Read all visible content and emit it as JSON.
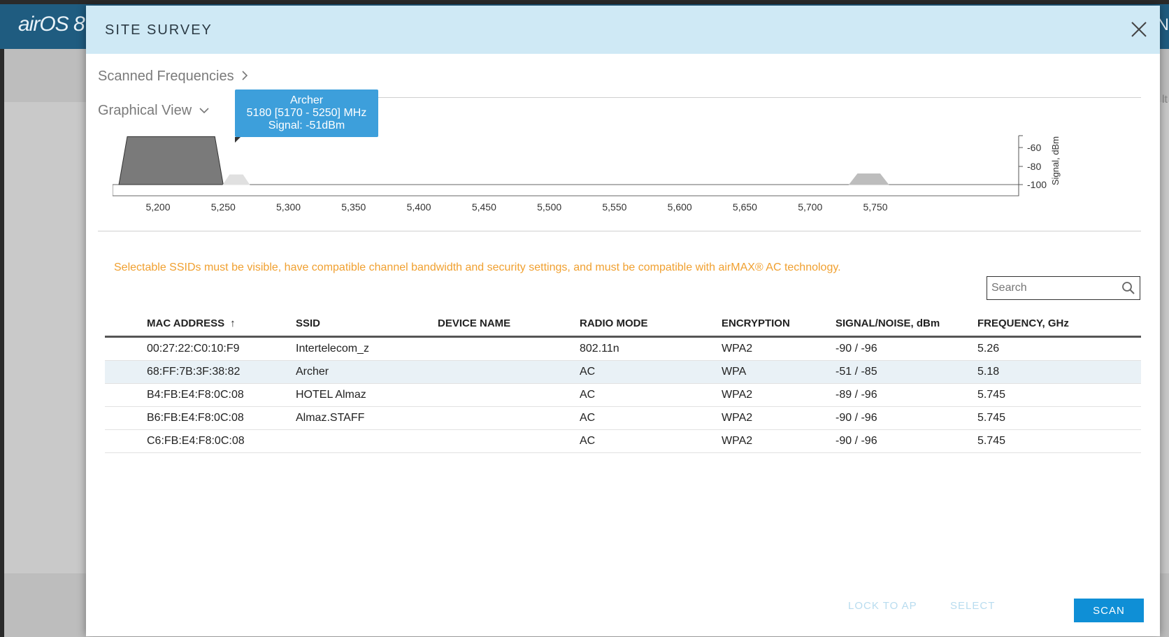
{
  "app": {
    "logo": "airOS 8",
    "edge_letter": "N",
    "edge_text": "lt"
  },
  "modal": {
    "title": "SITE SURVEY",
    "scanned_frequencies_label": "Scanned Frequencies",
    "graphical_view_label": "Graphical View",
    "tooltip": {
      "ssid": "Archer",
      "freq": "5180 [5170 - 5250] MHz",
      "signal": "Signal: -51dBm"
    },
    "notice": "Selectable SSIDs must be visible, have compatible channel bandwidth and security settings, and must be compatible with airMAX® AC technology.",
    "search": {
      "placeholder": "Search",
      "value": ""
    },
    "table": {
      "headers": [
        "MAC ADDRESS",
        "SSID",
        "DEVICE NAME",
        "RADIO MODE",
        "ENCRYPTION",
        "SIGNAL/NOISE, dBm",
        "FREQUENCY, GHz"
      ],
      "sort_arrow": "↑",
      "rows": [
        [
          "00:27:22:C0:10:F9",
          "Intertelecom_z",
          "",
          "802.11n",
          "WPA2",
          "-90 / -96",
          "5.26"
        ],
        [
          "68:FF:7B:3F:38:82",
          "Archer",
          "",
          "AC",
          "WPA",
          "-51 / -85",
          "5.18"
        ],
        [
          "B4:FB:E4:F8:0C:08",
          "HOTEL Almaz",
          "",
          "AC",
          "WPA2",
          "-89 / -96",
          "5.745"
        ],
        [
          "B6:FB:E4:F8:0C:08",
          "Almaz.STAFF",
          "",
          "AC",
          "WPA2",
          "-90 / -96",
          "5.745"
        ],
        [
          "C6:FB:E4:F8:0C:08",
          "",
          "",
          "AC",
          "WPA2",
          "-90 / -96",
          "5.745"
        ]
      ]
    },
    "buttons": {
      "lock_to_ap": "LOCK TO AP",
      "select": "SELECT",
      "scan": "SCAN"
    }
  },
  "chart_data": {
    "type": "area",
    "xlim": [
      5170,
      5770
    ],
    "ylim": [
      -100,
      -50
    ],
    "x_ticks": [
      "5,200",
      "5,250",
      "5,300",
      "5,350",
      "5,400",
      "5,450",
      "5,500",
      "5,550",
      "5,600",
      "5,650",
      "5,700",
      "5,750"
    ],
    "x_tick_values": [
      5200,
      5250,
      5300,
      5350,
      5400,
      5450,
      5500,
      5550,
      5600,
      5650,
      5700,
      5750
    ],
    "y_ticks": [
      "-60",
      "-80",
      "-100"
    ],
    "y_tick_values": [
      -60,
      -80,
      -100
    ],
    "ylabel": "Signal, dBm",
    "series": [
      {
        "name": "Archer",
        "range": [
          5170,
          5250
        ],
        "signal": -51,
        "color": "#7a7a7a"
      },
      {
        "name": "Intertelecom_z",
        "range": [
          5250,
          5270
        ],
        "signal": -90,
        "color": "#e0e0e0"
      },
      {
        "name": "HOTEL Almaz",
        "range": [
          5730,
          5760
        ],
        "signal": -89,
        "color": "#bdbdbd"
      }
    ]
  }
}
